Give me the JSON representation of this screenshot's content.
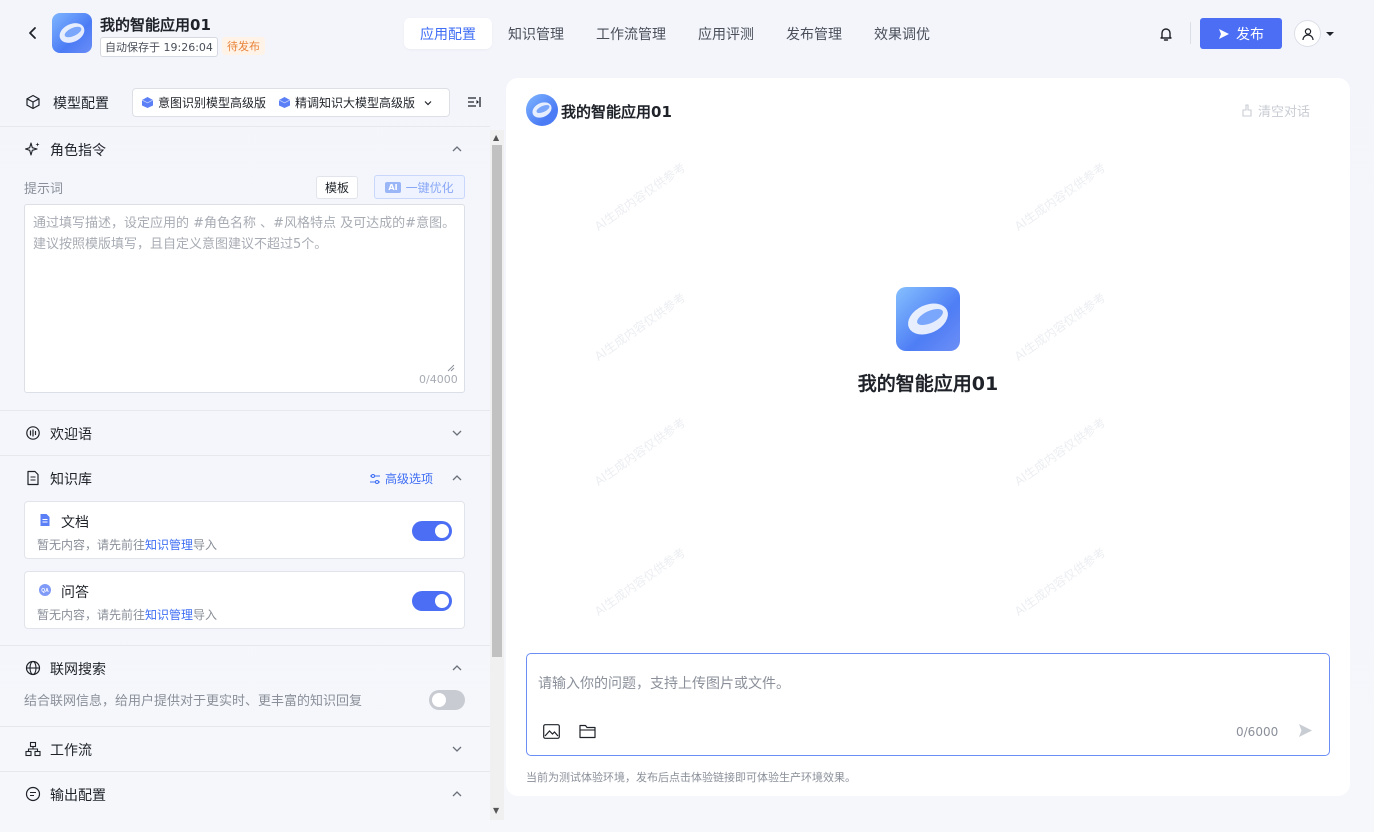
{
  "header": {
    "app_title": "我的智能应用01",
    "autosave": "自动保存于 19:26:04",
    "status": "待发布",
    "tabs": [
      "应用配置",
      "知识管理",
      "工作流管理",
      "应用评测",
      "发布管理",
      "效果调优"
    ],
    "active_tab": "应用配置",
    "publish_label": "发布"
  },
  "left": {
    "model_label": "模型配置",
    "models": [
      "意图识别模型高级版",
      "精调知识大模型高级版"
    ],
    "role": {
      "title": "角色指令",
      "prompt_label": "提示词",
      "template_btn": "模板",
      "ai_tag": "AI",
      "optimize_btn": "一键优化",
      "placeholder": "通过填写描述，设定应用的 #角色名称 、#风格特点 及可达成的#意图。 建议按照模版填写，且自定义意图建议不超过5个。",
      "count": "0/4000"
    },
    "welcome": {
      "title": "欢迎语"
    },
    "kb": {
      "title": "知识库",
      "advanced": "高级选项",
      "cards": [
        {
          "title": "文档",
          "desc_prefix": "暂无内容，请先前往",
          "link": "知识管理",
          "desc_suffix": "导入",
          "enabled": true
        },
        {
          "title": "问答",
          "desc_prefix": "暂无内容，请先前往",
          "link": "知识管理",
          "desc_suffix": "导入",
          "enabled": true
        }
      ]
    },
    "web": {
      "title": "联网搜索",
      "desc": "结合联网信息，给用户提供对于更实时、更丰富的知识回复",
      "enabled": false
    },
    "workflow": {
      "title": "工作流"
    },
    "output": {
      "title": "输出配置"
    }
  },
  "right": {
    "chat_title": "我的智能应用01",
    "clear_label": "清空对话",
    "center_title": "我的智能应用01",
    "watermark": "AI生成内容仅供参考",
    "input_placeholder": "请输入你的问题，支持上传图片或文件。",
    "count": "0/6000",
    "env_note": "当前为测试体验环境，发布后点击体验链接即可体验生产环境效果。"
  },
  "colors": {
    "accent": "#4b6ef5",
    "status": "#e8833a"
  }
}
